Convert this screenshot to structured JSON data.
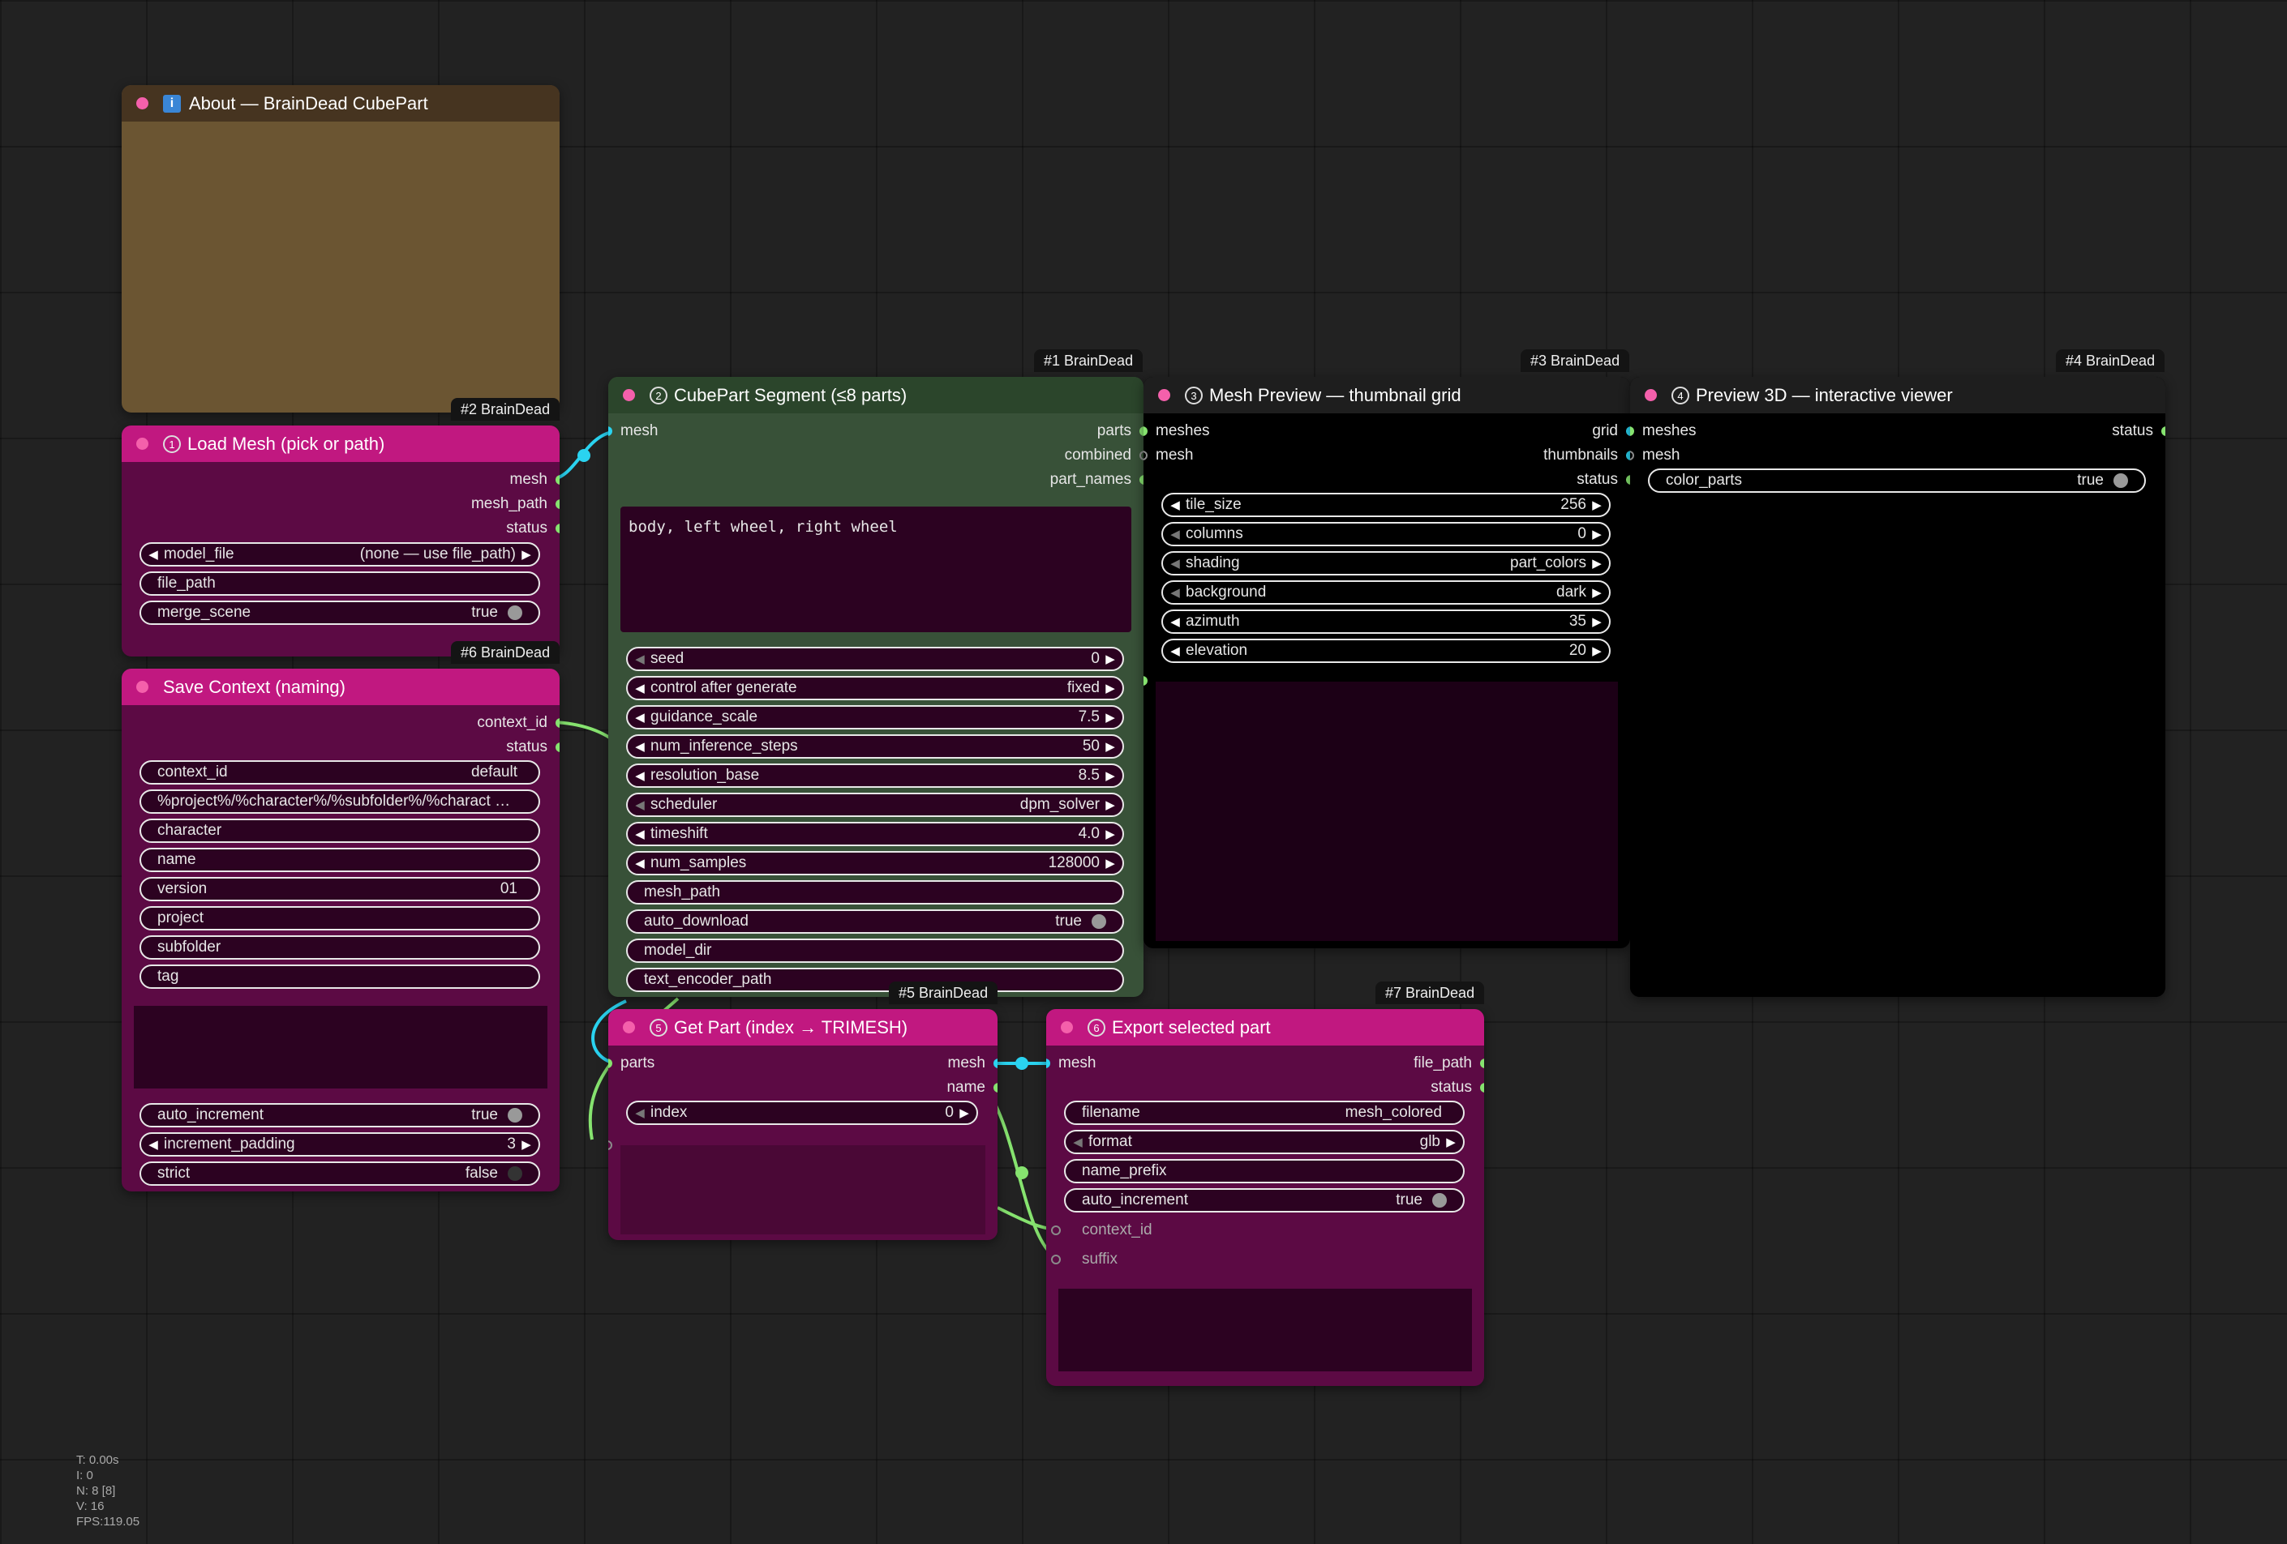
{
  "nodes": {
    "about": {
      "title": "About — BrainDead CubePart"
    },
    "load_mesh": {
      "badge": "#2 BrainDead",
      "num": "1",
      "title": "Load Mesh (pick or path)",
      "outputs": [
        "mesh",
        "mesh_path",
        "status"
      ],
      "model_file": {
        "name": "model_file",
        "value": "(none — use file_path)"
      },
      "file_path": {
        "name": "file_path"
      },
      "merge_scene": {
        "name": "merge_scene",
        "value": "true"
      }
    },
    "save_context": {
      "badge": "#6 BrainDead",
      "title": "Save Context (naming)",
      "outputs": [
        "context_id",
        "status"
      ],
      "context_id": {
        "name": "context_id",
        "value": "default"
      },
      "template": {
        "value": "%project%/%character%/%subfolder%/%charact …"
      },
      "character": {
        "name": "character"
      },
      "name_w": {
        "name": "name"
      },
      "version": {
        "name": "version",
        "value": "01"
      },
      "project": {
        "name": "project"
      },
      "subfolder": {
        "name": "subfolder"
      },
      "tag": {
        "name": "tag"
      },
      "auto_increment": {
        "name": "auto_increment",
        "value": "true"
      },
      "increment_padding": {
        "name": "increment_padding",
        "value": "3"
      },
      "strict": {
        "name": "strict",
        "value": "false"
      }
    },
    "segment": {
      "badge": "#1 BrainDead",
      "num": "2",
      "title": "CubePart Segment (≤8 parts)",
      "inputs": [
        "mesh"
      ],
      "outputs": [
        "parts",
        "combined",
        "part_names"
      ],
      "prompt": "body, left wheel, right wheel",
      "seed": {
        "name": "seed",
        "value": "0"
      },
      "control": {
        "name": "control after generate",
        "value": "fixed"
      },
      "guidance": {
        "name": "guidance_scale",
        "value": "7.5"
      },
      "steps": {
        "name": "num_inference_steps",
        "value": "50"
      },
      "resolution": {
        "name": "resolution_base",
        "value": "8.5"
      },
      "scheduler": {
        "name": "scheduler",
        "value": "dpm_solver"
      },
      "timeshift": {
        "name": "timeshift",
        "value": "4.0"
      },
      "samples": {
        "name": "num_samples",
        "value": "128000"
      },
      "mesh_path": {
        "name": "mesh_path"
      },
      "auto_download": {
        "name": "auto_download",
        "value": "true"
      },
      "model_dir": {
        "name": "model_dir"
      },
      "text_encoder_path": {
        "name": "text_encoder_path"
      }
    },
    "mesh_preview": {
      "badge": "#3 BrainDead",
      "num": "3",
      "title": "Mesh Preview — thumbnail grid",
      "inputs": [
        "meshes",
        "mesh"
      ],
      "outputs": [
        "grid",
        "thumbnails",
        "status"
      ],
      "tile_size": {
        "name": "tile_size",
        "value": "256"
      },
      "columns": {
        "name": "columns",
        "value": "0"
      },
      "shading": {
        "name": "shading",
        "value": "part_colors"
      },
      "background": {
        "name": "background",
        "value": "dark"
      },
      "azimuth": {
        "name": "azimuth",
        "value": "35"
      },
      "elevation": {
        "name": "elevation",
        "value": "20"
      }
    },
    "preview3d": {
      "badge": "#4 BrainDead",
      "num": "4",
      "title": "Preview 3D — interactive viewer",
      "inputs": [
        "meshes",
        "mesh"
      ],
      "outputs": [
        "status"
      ],
      "color_parts": {
        "name": "color_parts",
        "value": "true"
      }
    },
    "get_part": {
      "badge": "#5 BrainDead",
      "num": "5",
      "title": "Get Part (index → TRIMESH)",
      "inputs": [
        "parts"
      ],
      "outputs": [
        "mesh",
        "name"
      ],
      "index": {
        "name": "index",
        "value": "0"
      }
    },
    "export": {
      "badge": "#7 BrainDead",
      "num": "6",
      "title": "Export selected part",
      "inputs": [
        "mesh",
        "context_id",
        "suffix"
      ],
      "outputs": [
        "file_path",
        "status"
      ],
      "filename": {
        "name": "filename",
        "value": "mesh_colored"
      },
      "format": {
        "name": "format",
        "value": "glb"
      },
      "name_prefix": {
        "name": "name_prefix"
      },
      "auto_increment": {
        "name": "auto_increment",
        "value": "true"
      }
    }
  },
  "stats": [
    "T: 0.00s",
    "I: 0",
    "N: 8 [8]",
    "V: 16",
    "FPS:119.05"
  ],
  "colors": {
    "canvas": "#222222",
    "node_pink": "#5c0a44",
    "title_pink": "#c11880",
    "node_green": "#385138",
    "wire_green": "#86e36f",
    "wire_cyan": "#2ad3f0",
    "slot_dot": "#f460ab"
  }
}
